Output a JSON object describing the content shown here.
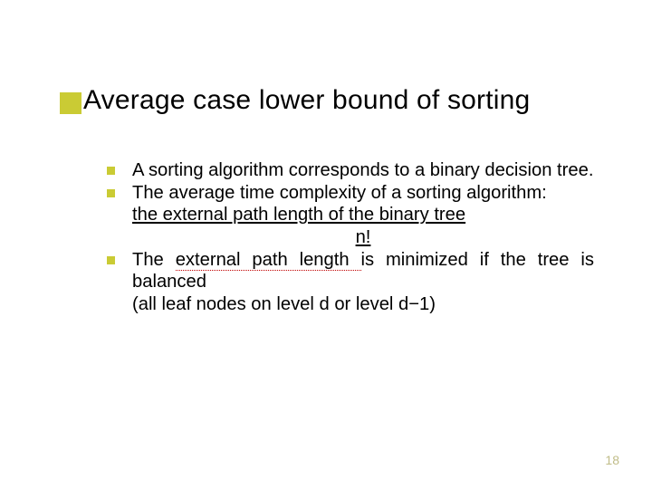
{
  "title": "Average case lower bound of sorting",
  "bullets": [
    {
      "text": "A sorting algorithm corresponds to a binary decision tree."
    },
    {
      "text": "The average time complexity of a sorting algorithm:",
      "sub_underline": "the external path length of the binary tree",
      "sub_center_underline": "n!"
    },
    {
      "prefix": "The ",
      "highlight": "external path length ",
      "suffix": "is minimized if the tree is balanced",
      "paren": "(all leaf nodes on level d or level d−1)"
    }
  ],
  "page_number": "18"
}
